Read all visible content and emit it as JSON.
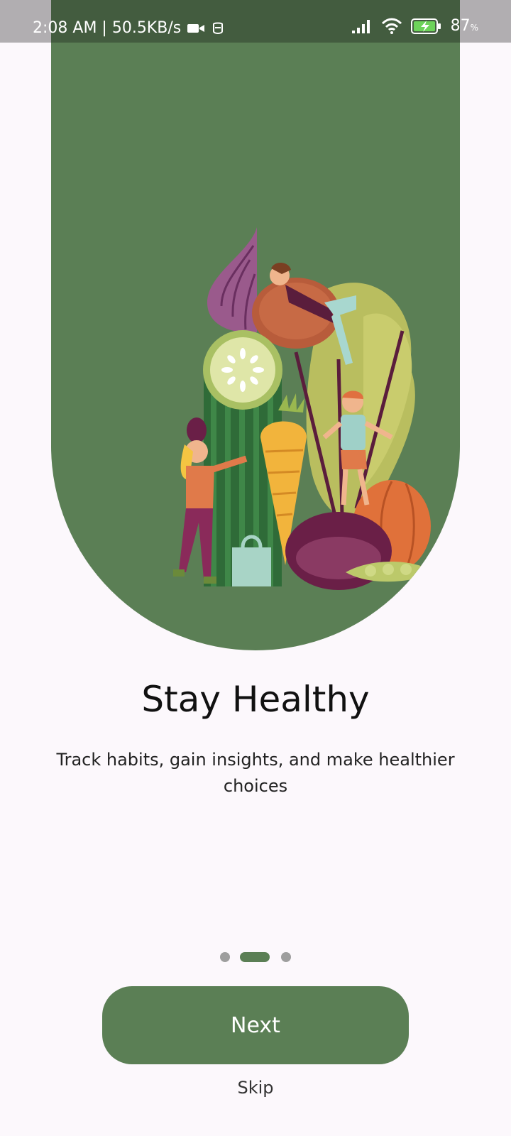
{
  "status_bar": {
    "time_speed": "2:08 AM | 50.5KB/s",
    "battery": "87",
    "battery_unit": "%",
    "icons": [
      "video-camera-icon",
      "notification-icon",
      "signal-icon",
      "wifi-icon",
      "battery-charging-icon"
    ]
  },
  "onboarding": {
    "title": "Stay Healthy",
    "subtitle": "Track habits, gain insights, and make healthier choices",
    "page_indicator": {
      "total": 3,
      "active_index": 1
    },
    "next_label": "Next",
    "skip_label": "Skip",
    "colors": {
      "accent": "#5b7f55",
      "background": "#fcf8fc"
    }
  }
}
